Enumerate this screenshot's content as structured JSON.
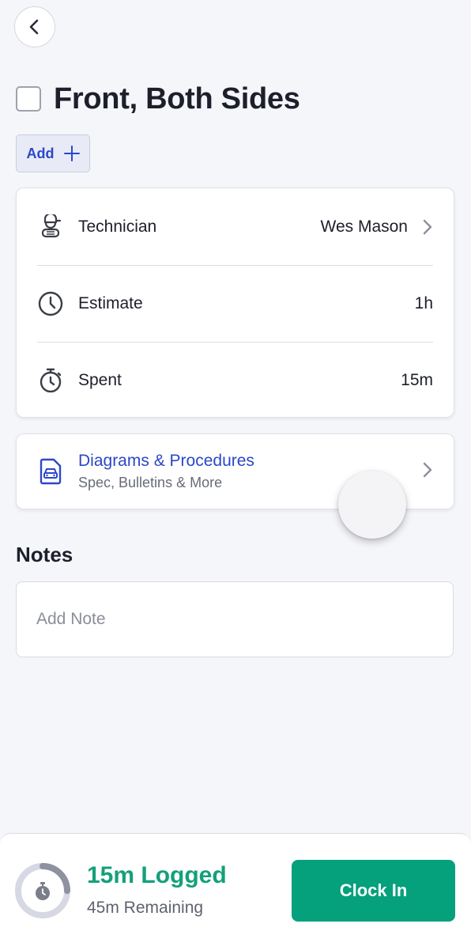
{
  "header": {
    "back_icon": "chevron-left-icon",
    "title": "Front, Both Sides",
    "checked": false,
    "add_label": "Add"
  },
  "details": {
    "technician": {
      "label": "Technician",
      "value": "Wes Mason",
      "icon": "technician-icon"
    },
    "estimate": {
      "label": "Estimate",
      "value": "1h",
      "icon": "clock-icon"
    },
    "spent": {
      "label": "Spent",
      "value": "15m",
      "icon": "stopwatch-icon"
    }
  },
  "diagrams": {
    "title": "Diagrams & Procedures",
    "subtitle": "Spec, Bulletins & More",
    "icon": "car-document-icon"
  },
  "notes": {
    "heading": "Notes",
    "placeholder": "Add Note",
    "value": ""
  },
  "footer": {
    "logged": "15m Logged",
    "remaining": "45m Remaining",
    "logged_fraction": 0.25,
    "clock_in_label": "Clock In"
  },
  "colors": {
    "accent_blue": "#2b47c9",
    "accent_green": "#05a07c",
    "logged_green": "#13a07b",
    "background": "#f5f6fa"
  }
}
